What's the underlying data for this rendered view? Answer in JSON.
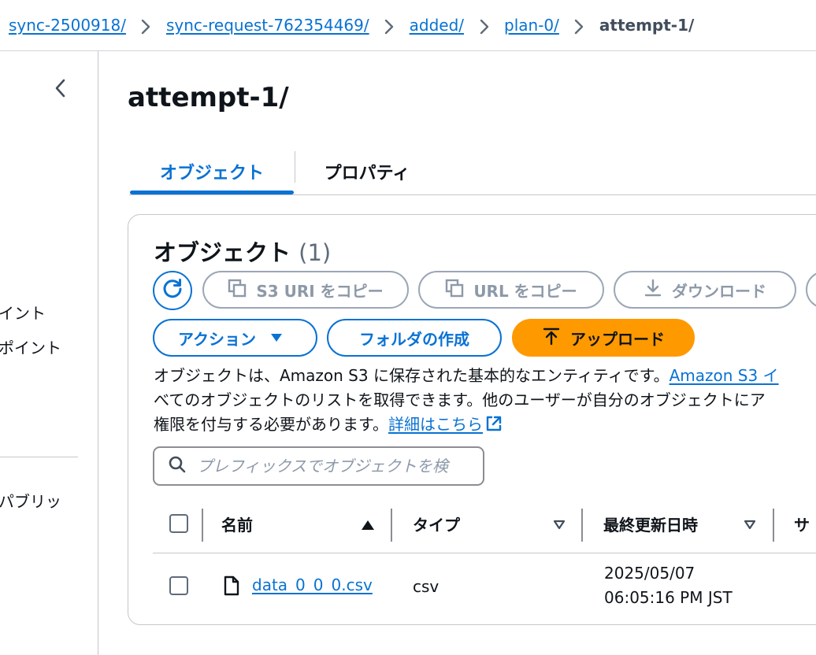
{
  "breadcrumb": {
    "items": [
      "sync-2500918/",
      "sync-request-762354469/",
      "added/",
      "plan-0/"
    ],
    "current": "attempt-1/"
  },
  "sidebar": {
    "items": [
      "イント",
      "ポイント",
      "パブリッ"
    ]
  },
  "page": {
    "title": "attempt-1/"
  },
  "tabs": [
    {
      "label": "オブジェクト",
      "active": true
    },
    {
      "label": "プロパティ",
      "active": false
    }
  ],
  "objects": {
    "heading": "オブジェクト",
    "count": "(1)",
    "buttons": {
      "copy_s3_uri": "S3 URI をコピー",
      "copy_url": "URL をコピー",
      "download": "ダウンロード",
      "actions": "アクション",
      "create_folder": "フォルダの作成",
      "upload": "アップロード"
    },
    "description": {
      "line1": "オブジェクトは、Amazon S3 に保存された基本的なエンティティです。",
      "line1_link": "Amazon S3 イ",
      "line2": "べてのオブジェクトのリストを取得できます。他のユーザーが自分のオブジェクトにア",
      "line3": "権限を付与する必要があります。",
      "details_link": "詳細はこちら"
    },
    "search": {
      "placeholder": "プレフィックスでオブジェクトを検"
    },
    "columns": [
      "名前",
      "タイプ",
      "最終更新日時",
      "サ"
    ],
    "rows": [
      {
        "name": "data_0_0_0.csv",
        "type": "csv",
        "modified_date": "2025/05/07",
        "modified_time": "06:05:16 PM JST"
      }
    ]
  },
  "colors": {
    "link": "#0972d3",
    "primary_button": "#ff9900",
    "disabled": "#8d99a8"
  },
  "icons": [
    "chevron-right-icon",
    "chevron-left-icon",
    "refresh-icon",
    "copy-icon",
    "download-icon",
    "caret-down-icon",
    "upload-icon",
    "external-link-icon",
    "search-icon",
    "sort-ascending-icon",
    "sort-descending-icon",
    "file-icon"
  ]
}
